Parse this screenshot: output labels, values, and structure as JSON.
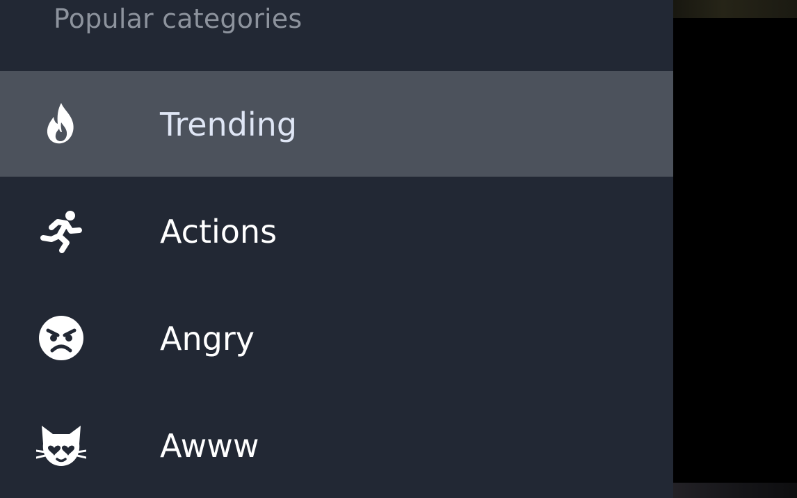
{
  "drawer": {
    "section_title": "Popular categories",
    "items": [
      {
        "label": "Trending",
        "icon": "fire-icon",
        "selected": true
      },
      {
        "label": "Actions",
        "icon": "running-person-icon",
        "selected": false
      },
      {
        "label": "Angry",
        "icon": "angry-face-icon",
        "selected": false
      },
      {
        "label": "Awww",
        "icon": "heart-eyes-cat-icon",
        "selected": false
      }
    ]
  },
  "colors": {
    "drawer_background": "#222834",
    "selected_row_background": "#4c525c",
    "section_title_text": "#8d939d",
    "item_text": "#ffffff",
    "selected_item_text": "#dfe6f5",
    "scrim": "#000000"
  }
}
